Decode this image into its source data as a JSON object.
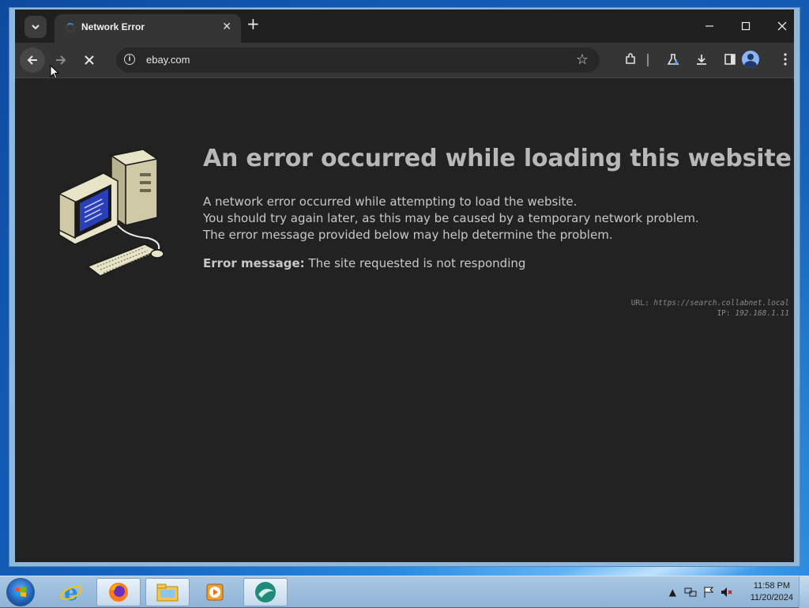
{
  "browser": {
    "tab_title": "Network Error",
    "url": "ebay.com",
    "new_tab_symbol": "+",
    "tab_close_symbol": "✕"
  },
  "page": {
    "heading": "An error occurred while loading this website",
    "body_lines": [
      "A network error occurred while attempting to load the website.",
      "You should try again later, as this may be caused by a temporary network problem.",
      "The error message provided below may help determine the problem."
    ],
    "error_label": "Error message:",
    "error_text": "The site requested is not responding",
    "meta_url_label": "URL:",
    "meta_url": "https://search.collabnet.local",
    "meta_ip_label": "IP:",
    "meta_ip": "192.168.1.11"
  },
  "taskbar": {
    "apps": [
      "internet-explorer-icon",
      "firefox-icon",
      "file-explorer-icon",
      "media-player-icon",
      "app-icon"
    ],
    "clock_time": "11:58 PM",
    "clock_date": "11/20/2024"
  },
  "colors": {
    "page_bg": "#222222",
    "heading": "#b8b8b8",
    "text": "#c8c8c8",
    "toolbar": "#353535",
    "tabstrip": "#1f1f1f"
  }
}
